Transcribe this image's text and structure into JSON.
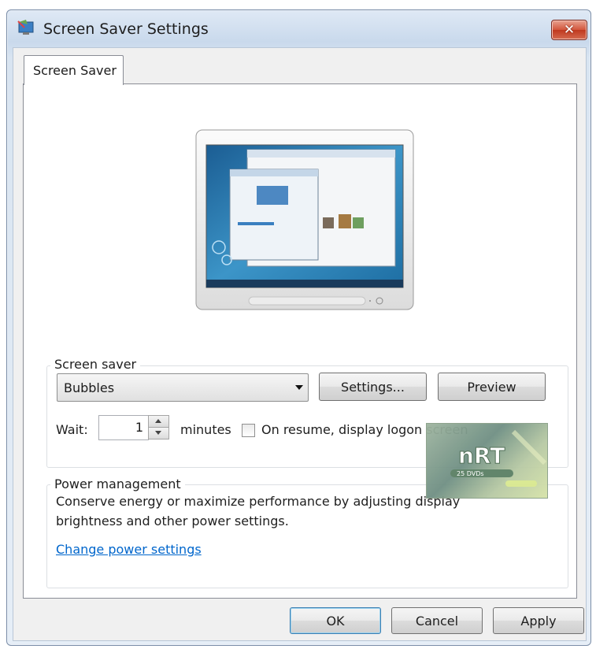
{
  "window": {
    "title": "Screen Saver Settings",
    "close_glyph": "✕"
  },
  "tabs": [
    {
      "label": "Screen Saver",
      "selected": true
    }
  ],
  "screen_saver": {
    "group_label": "Screen saver",
    "selected": "Bubbles",
    "settings_label": "Settings...",
    "preview_label": "Preview",
    "wait_label": "Wait:",
    "wait_value": "1",
    "minutes_label": "minutes",
    "on_resume_label": "On resume, display logon screen",
    "on_resume_checked": false
  },
  "power": {
    "group_label": "Power management",
    "description_line1": "Conserve energy or maximize performance by adjusting display",
    "description_line2": "brightness and other power settings.",
    "link_label": "Change power settings"
  },
  "footer": {
    "ok_label": "OK",
    "cancel_label": "Cancel",
    "apply_label": "Apply"
  },
  "watermark": {
    "logo": "nRT",
    "text": "25 DVDs"
  },
  "colors": {
    "link": "#0066cc",
    "close_button": "#c9432a",
    "desktop_preview": "#2a7fb5"
  }
}
